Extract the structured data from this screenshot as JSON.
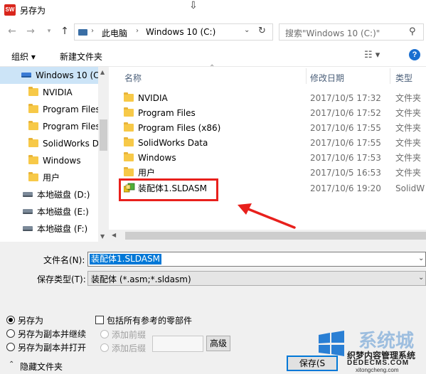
{
  "window": {
    "title": "另存为",
    "app_icon_text": "SW"
  },
  "address_bar": {
    "segments": [
      "此电脑",
      "Windows 10 (C:)"
    ]
  },
  "search": {
    "placeholder": "搜索\"Windows 10 (C:)\""
  },
  "toolbar": {
    "organize_label": "组织 ▾",
    "new_folder_label": "新建文件夹"
  },
  "nav_pane": {
    "items": [
      {
        "label": "Windows 10 (C",
        "kind": "drive",
        "selected": true
      },
      {
        "label": "NVIDIA",
        "kind": "folder"
      },
      {
        "label": "Program Files",
        "kind": "folder"
      },
      {
        "label": "Program Files",
        "kind": "folder"
      },
      {
        "label": "SolidWorks D",
        "kind": "folder"
      },
      {
        "label": "Windows",
        "kind": "folder"
      },
      {
        "label": "用户",
        "kind": "folder"
      },
      {
        "label": "本地磁盘 (D:)",
        "kind": "drive"
      },
      {
        "label": "本地磁盘 (E:)",
        "kind": "drive"
      },
      {
        "label": "本地磁盘 (F:)",
        "kind": "drive"
      }
    ]
  },
  "file_list": {
    "columns": {
      "name": "名称",
      "date": "修改日期",
      "type": "类型"
    },
    "rows": [
      {
        "name": "NVIDIA",
        "date": "2017/10/5 17:32",
        "type": "文件夹"
      },
      {
        "name": "Program Files",
        "date": "2017/10/6 17:52",
        "type": "文件夹"
      },
      {
        "name": "Program Files (x86)",
        "date": "2017/10/6 17:55",
        "type": "文件夹"
      },
      {
        "name": "SolidWorks Data",
        "date": "2017/10/6 17:55",
        "type": "文件夹"
      },
      {
        "name": "Windows",
        "date": "2017/10/6 17:53",
        "type": "文件夹"
      },
      {
        "name": "用户",
        "date": "2017/10/5 16:53",
        "type": "文件夹"
      },
      {
        "name": "装配体1.SLDASM",
        "date": "2017/10/6 19:20",
        "type": "SolidW"
      }
    ]
  },
  "form": {
    "filename_label": "文件名(N):",
    "filename_value": "装配体1.SLDASM",
    "savetype_label": "保存类型(T):",
    "savetype_value": "装配体 (*.asm;*.sldasm)"
  },
  "options": {
    "save_as": "另存为",
    "save_as_copy_continue": "另存为副本并继续",
    "save_as_copy_open": "另存为副本并打开",
    "include_refs": "包括所有参考的零部件",
    "add_prefix": "添加前缀",
    "add_suffix": "添加后缀",
    "advanced_button": "高级"
  },
  "footer": {
    "hide_folders": "隐藏文件夹",
    "save_button": "保存(S"
  },
  "watermark": {
    "line1": "系统城",
    "line2": "织梦内容管理系统",
    "line3": "DEDECMS.COM",
    "line4": "xitongcheng.com"
  },
  "colors": {
    "accent": "#0078d7",
    "highlight": "#e8201c",
    "selection": "#cce4f7"
  }
}
